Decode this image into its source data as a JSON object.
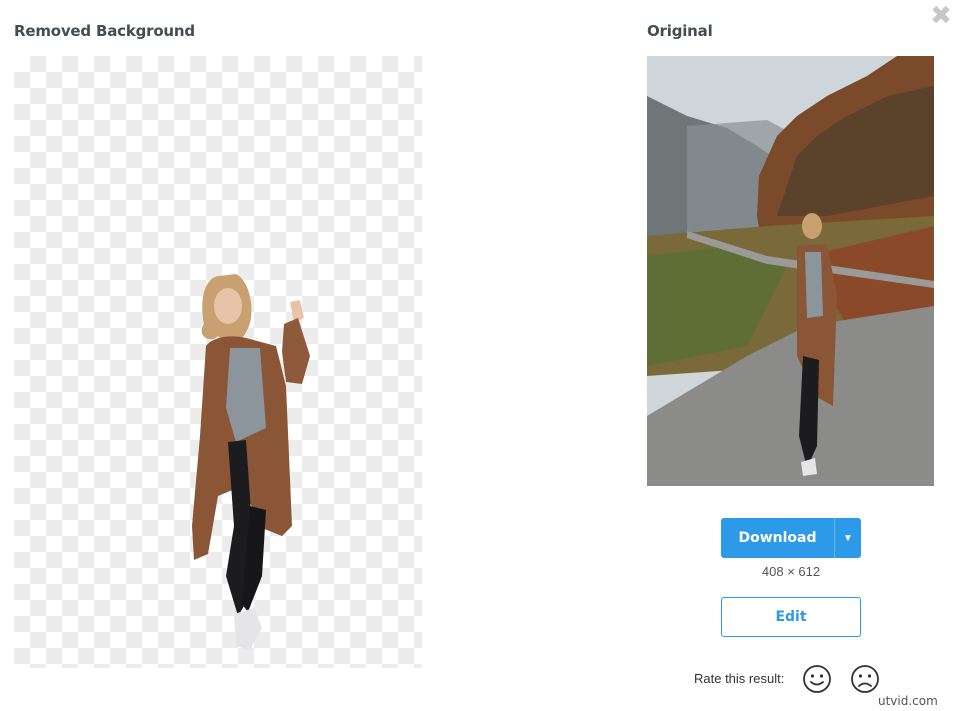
{
  "panels": {
    "removed_title": "Removed Background",
    "original_title": "Original"
  },
  "actions": {
    "download_label": "Download",
    "dimensions": "408 × 612",
    "edit_label": "Edit"
  },
  "rating": {
    "label": "Rate this result:"
  },
  "watermark": "utvid.com",
  "icons": {
    "close": "close-icon",
    "dropdown": "caret-down-icon",
    "happy": "smile-icon",
    "sad": "frown-icon"
  },
  "colors": {
    "accent": "#2d9ae9",
    "heading": "#454c53"
  }
}
